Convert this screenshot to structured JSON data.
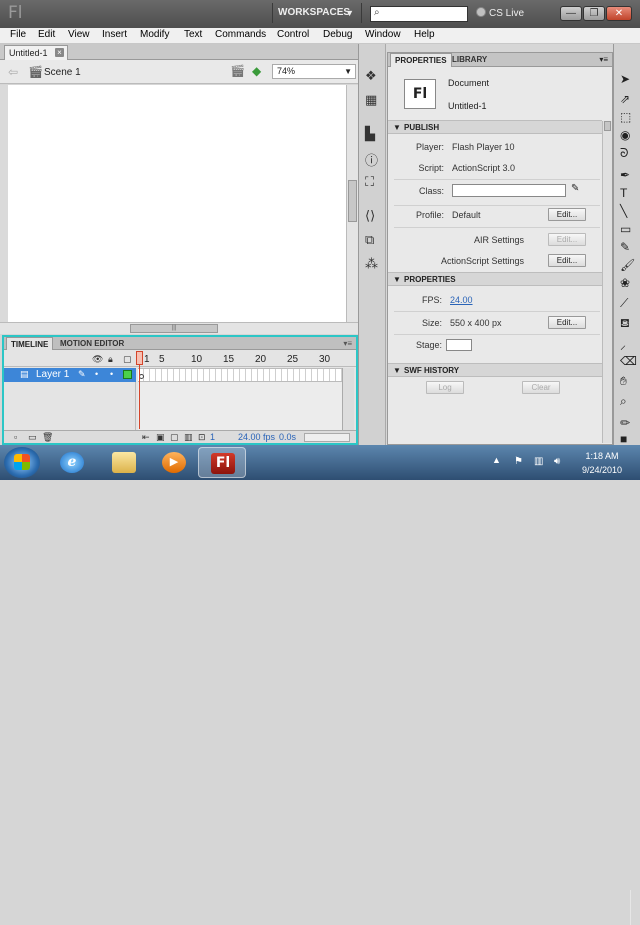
{
  "app": {
    "logo_text": "Fl",
    "workspaces_label": "WORKSPACES",
    "search_placeholder": "",
    "cs_live_label": "CS Live",
    "window_buttons": {
      "minimize": "—",
      "maximize": "❐",
      "close": "✕"
    }
  },
  "menu": [
    "File",
    "Edit",
    "View",
    "Insert",
    "Modify",
    "Text",
    "Commands",
    "Control",
    "Debug",
    "Window",
    "Help"
  ],
  "document_tab": {
    "label": "Untitled-1",
    "close": "×"
  },
  "scene_bar": {
    "scene_label": "Scene 1",
    "zoom": "74%"
  },
  "timeline": {
    "tabs": [
      "TIMELINE",
      "MOTION EDITOR"
    ],
    "frame_numbers": [
      "1",
      "5",
      "10",
      "15",
      "20",
      "25",
      "30"
    ],
    "layer_name": "Layer 1",
    "current_frame": "1",
    "fps": "24.00",
    "fps_unit": "fps",
    "elapsed": "0.0",
    "elapsed_unit": "s"
  },
  "properties_panel": {
    "tabs": [
      "PROPERTIES",
      "LIBRARY"
    ],
    "doc_icon_text": "Fl",
    "doc_kind": "Document",
    "doc_name": "Untitled-1",
    "publish": {
      "header": "PUBLISH",
      "player_label": "Player:",
      "player_value": "Flash Player 10",
      "script_label": "Script:",
      "script_value": "ActionScript 3.0",
      "class_label": "Class:",
      "class_value": "",
      "profile_label": "Profile:",
      "profile_value": "Default",
      "profile_button": "Edit...",
      "air_label": "AIR Settings",
      "air_button": "Edit...",
      "as_label": "ActionScript Settings",
      "as_button": "Edit..."
    },
    "properties": {
      "header": "PROPERTIES",
      "fps_label": "FPS:",
      "fps_value": "24.00",
      "size_label": "Size:",
      "size_value": "550 x 400 px",
      "size_button": "Edit...",
      "stage_label": "Stage:",
      "stage_color": "#FFFFFF"
    },
    "swf_history": {
      "header": "SWF HISTORY",
      "log_button": "Log",
      "clear_button": "Clear"
    }
  },
  "taskbar": {
    "clock_time": "1:18 AM",
    "clock_date": "9/24/2010",
    "flash_icon_text": "Fl",
    "ie_icon_text": "e"
  },
  "colors": {
    "timeline_highlight": "#2bc6c6",
    "layer_selected": "#3d86d8",
    "playhead": "#d4452a",
    "link_blue": "#2a64b8"
  }
}
